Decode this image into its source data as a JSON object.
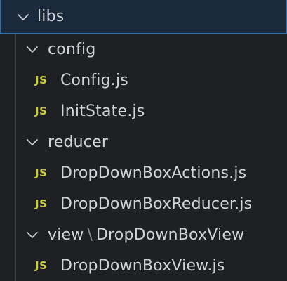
{
  "explorer": {
    "root": {
      "label": "libs",
      "icon": "chevron-down-icon"
    },
    "config_folder": {
      "label": "config",
      "icon": "chevron-down-icon",
      "files": [
        {
          "badge": "JS",
          "label": "Config.js"
        },
        {
          "badge": "JS",
          "label": "InitState.js"
        }
      ]
    },
    "reducer_folder": {
      "label": "reducer",
      "icon": "chevron-down-icon",
      "files": [
        {
          "badge": "JS",
          "label": "DropDownBoxActions.js"
        },
        {
          "badge": "JS",
          "label": "DropDownBoxReducer.js"
        }
      ]
    },
    "view_folder": {
      "label_part1": "view",
      "separator": "\\",
      "label_part2": "DropDownBoxView",
      "icon": "chevron-down-icon",
      "files": [
        {
          "badge": "JS",
          "label": "DropDownBoxView.js"
        }
      ]
    }
  },
  "colors": {
    "background": "#1f2023",
    "root_selected_bg": "#1c2a3d",
    "root_border": "#2f6fb0",
    "text": "#d0d4d9",
    "js_badge": "#cbcb41",
    "guide_line": "#3b3e44"
  }
}
